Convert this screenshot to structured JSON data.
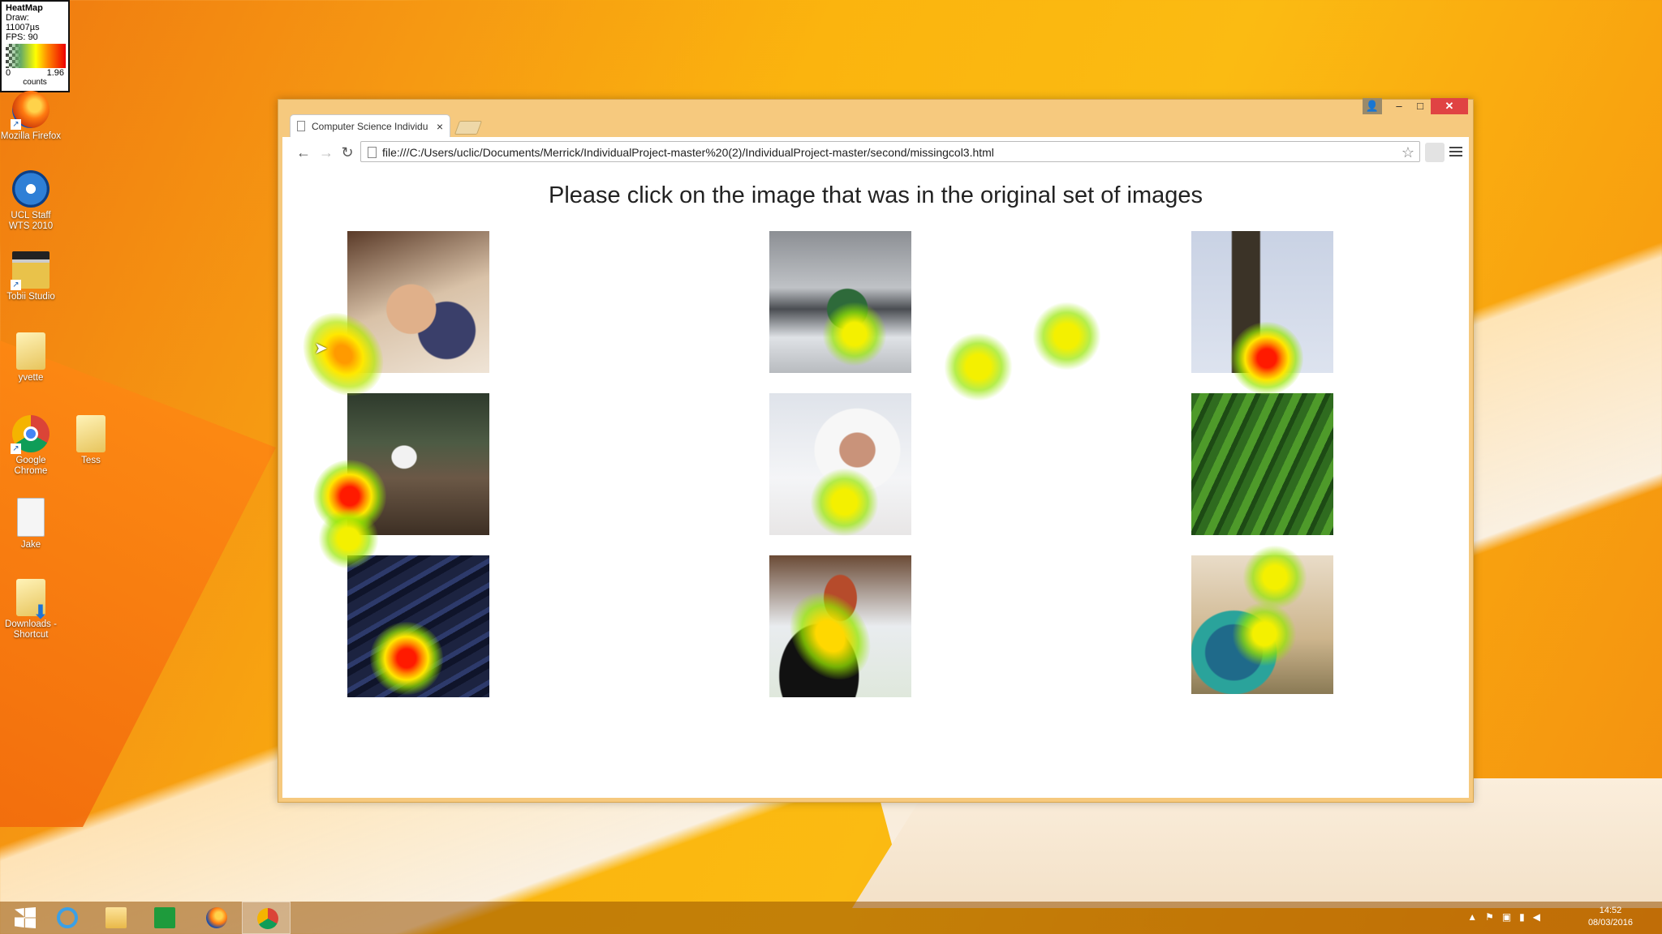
{
  "heatmap_legend": {
    "title": "HeatMap",
    "draw": "Draw: 11007µs",
    "fps": "FPS: 90",
    "min": "0",
    "max": "1.96",
    "unit": "counts"
  },
  "desktop_icons": [
    {
      "label": "Mozilla Firefox",
      "icon": "firefox-icon"
    },
    {
      "label": "UCL Staff WTS 2010",
      "icon": "ucl-wts-icon"
    },
    {
      "label": "Tobii Studio",
      "icon": "tobii-studio-icon"
    },
    {
      "label": "yvette",
      "icon": "folder-icon"
    },
    {
      "label": "Google Chrome",
      "icon": "chrome-icon"
    },
    {
      "label": "Tess",
      "icon": "folder-icon"
    },
    {
      "label": "Jake",
      "icon": "document-icon"
    },
    {
      "label": "Downloads - Shortcut",
      "icon": "downloads-folder-icon"
    }
  ],
  "browser": {
    "tab_title": "Computer Science Individu",
    "url": "file:///C:/Users/uclic/Documents/Merrick/IndividualProject-master%20(2)/IndividualProject-master/second/missingcol3.html"
  },
  "page": {
    "heading": "Please click on the image that was in the original set of images",
    "images": [
      {
        "subject": "sleeping child"
      },
      {
        "subject": "train in snow"
      },
      {
        "subject": "Big Ben clock tower"
      },
      {
        "subject": "headphones on forest path"
      },
      {
        "subject": "woman in white fur hood"
      },
      {
        "subject": "cucumbers"
      },
      {
        "subject": "backlit keyboard"
      },
      {
        "subject": "hot dog on plate"
      },
      {
        "subject": "blue parrot"
      }
    ]
  },
  "taskbar": {
    "items": [
      "start-icon",
      "internet-explorer-icon",
      "file-explorer-icon",
      "store-icon",
      "firefox-icon",
      "chrome-icon"
    ],
    "active": "chrome-icon",
    "time": "14:52",
    "date": "08/03/2016"
  }
}
